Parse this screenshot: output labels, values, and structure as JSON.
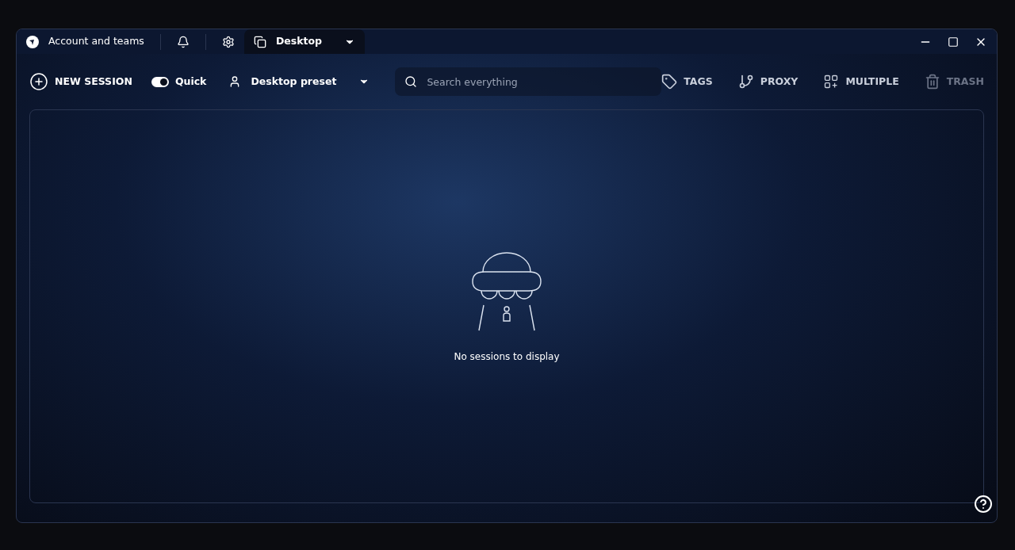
{
  "title_bar": {
    "account": "Account and teams",
    "tabs": [
      {
        "label": "Desktop",
        "selected": true
      }
    ]
  },
  "toolbar": {
    "new_session": "NEW SESSION",
    "quick": {
      "label": "Quick",
      "on": true
    },
    "preset": "Desktop preset",
    "search": {
      "placeholder": "Search everything"
    },
    "actions": [
      {
        "kind": "tags",
        "label": "TAGS",
        "disabled": false
      },
      {
        "kind": "proxy",
        "label": "PROXY",
        "disabled": false
      },
      {
        "kind": "multiple",
        "label": "MULTIPLE",
        "disabled": false
      },
      {
        "kind": "trash",
        "label": "TRASH",
        "disabled": true
      }
    ]
  },
  "empty_state": {
    "message": "No sessions to display"
  }
}
